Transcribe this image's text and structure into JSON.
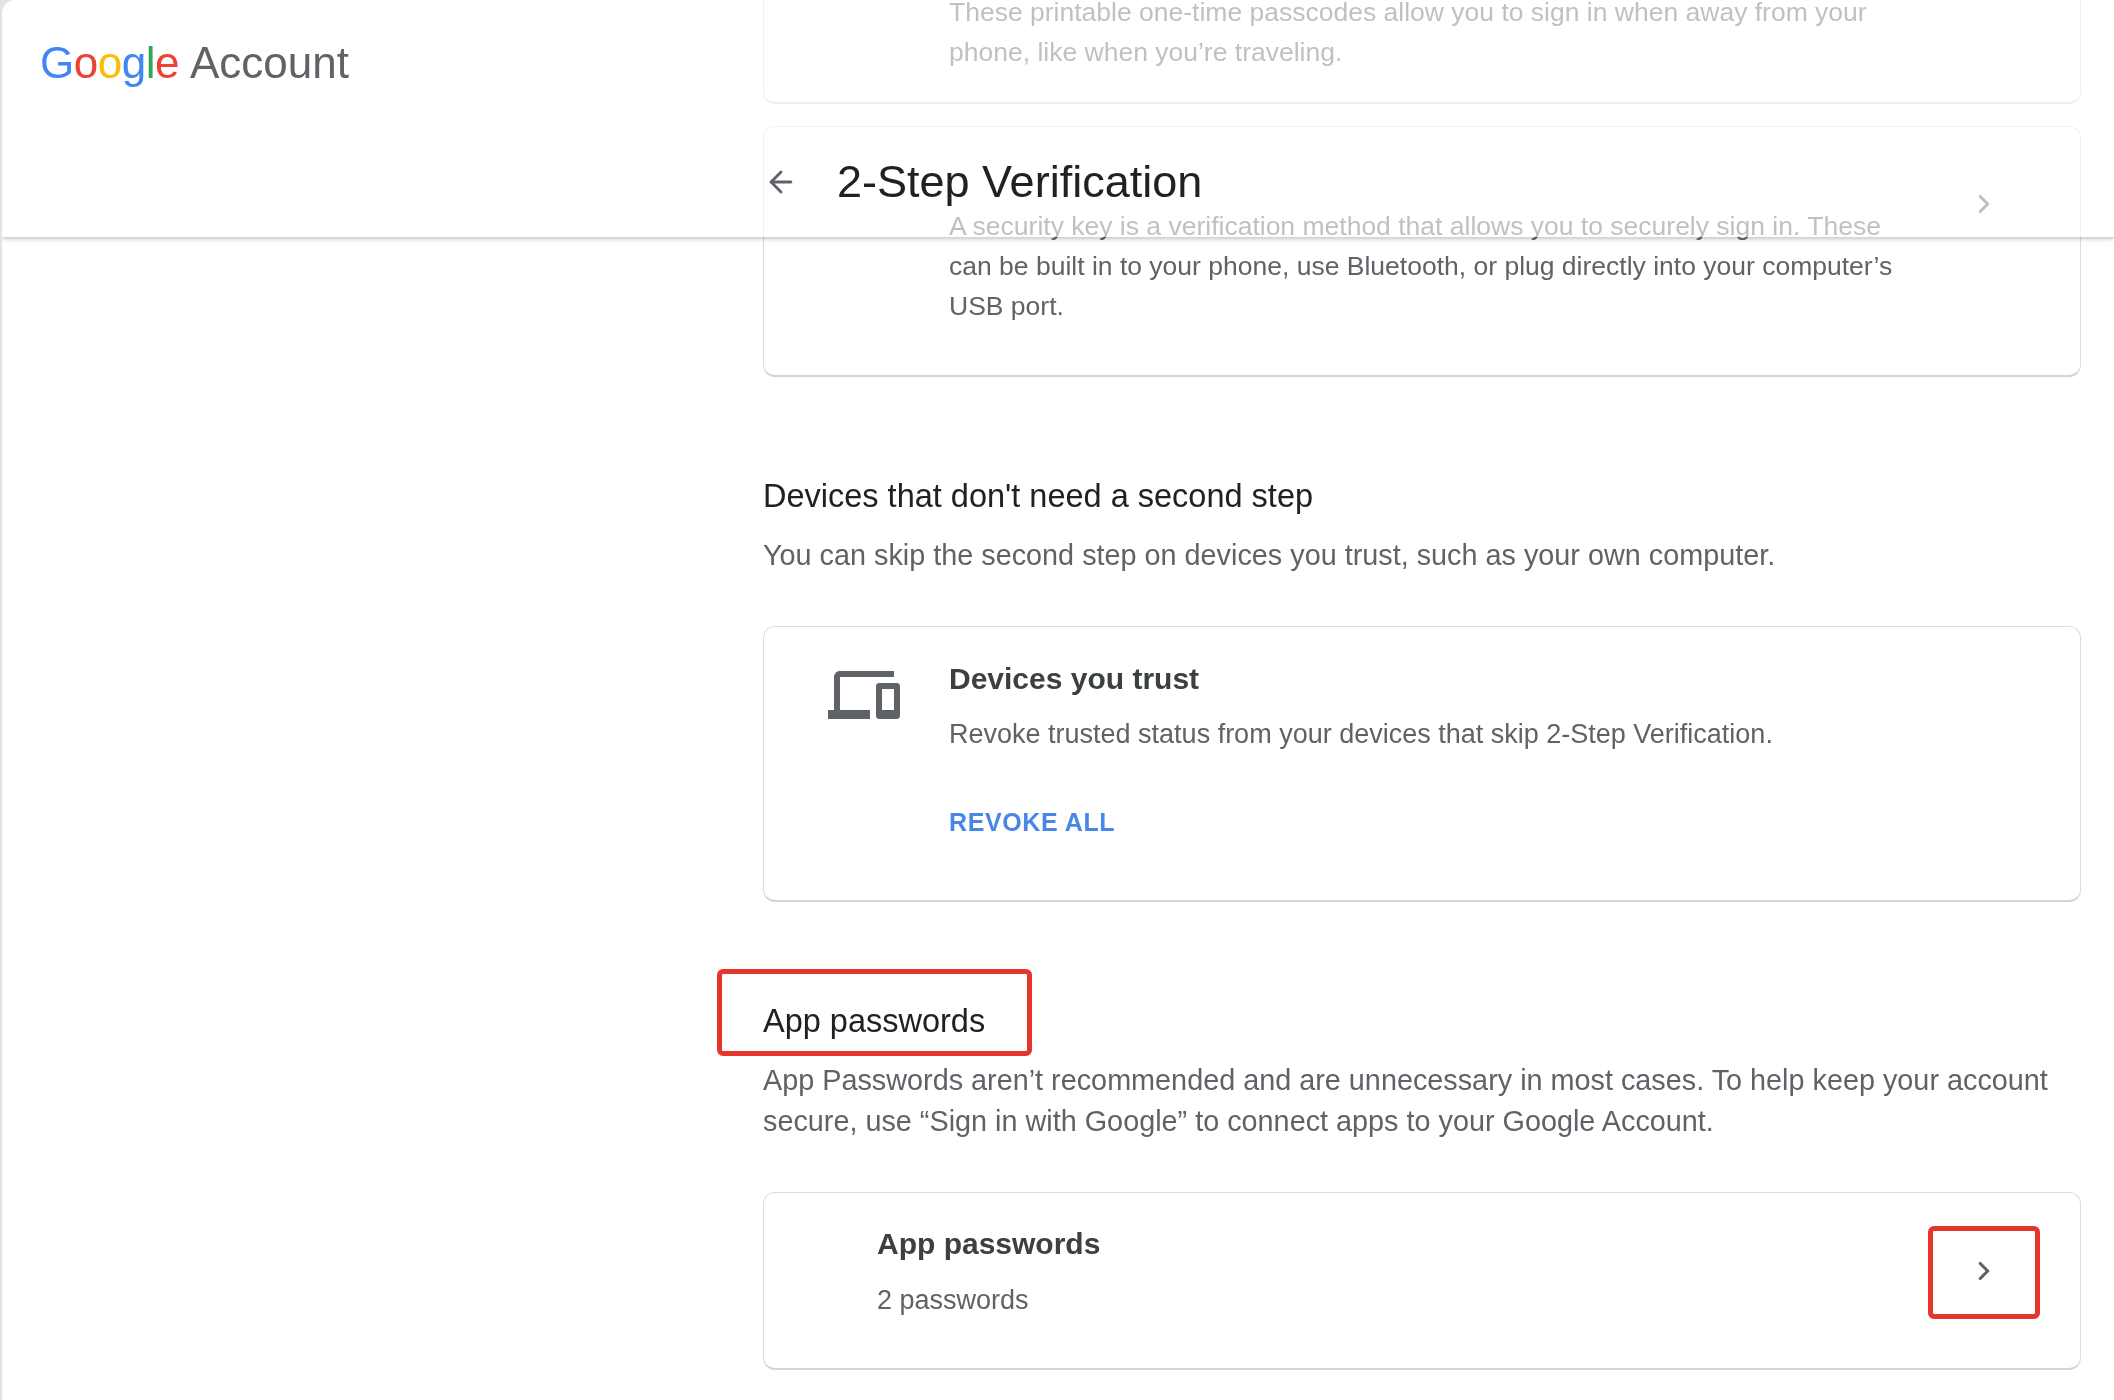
{
  "header": {
    "logo": {
      "brand": "Google",
      "product": "Account"
    },
    "title": "2-Step Verification"
  },
  "scrolled_cards": [
    {
      "description": "These printable one-time passcodes allow you to sign in when away from your phone, like when you’re traveling.",
      "chevron": false
    },
    {
      "description": "A security key is a verification method that allows you to securely sign in. These can be built in to your phone, use Bluetooth, or plug directly into your computer’s USB port.",
      "chevron": true
    }
  ],
  "sections": [
    {
      "heading": "Devices that don't need a second step",
      "highlighted": false,
      "description": "You can skip the second step on devices you trust, such as your own computer.",
      "card": {
        "kind": "action",
        "title": "Devices you trust",
        "description": "Revoke trusted status from your devices that skip 2-Step Verification.",
        "action": "REVOKE ALL"
      }
    },
    {
      "heading": "App passwords",
      "highlighted": true,
      "description": "App Passwords aren’t recommended and are unnecessary in most cases. To help keep your account secure, use “Sign in with Google” to connect apps to your Google Account.",
      "card": {
        "kind": "link",
        "title": "App passwords",
        "subtitle": "2 passwords",
        "chevron_highlighted": true
      }
    }
  ]
}
